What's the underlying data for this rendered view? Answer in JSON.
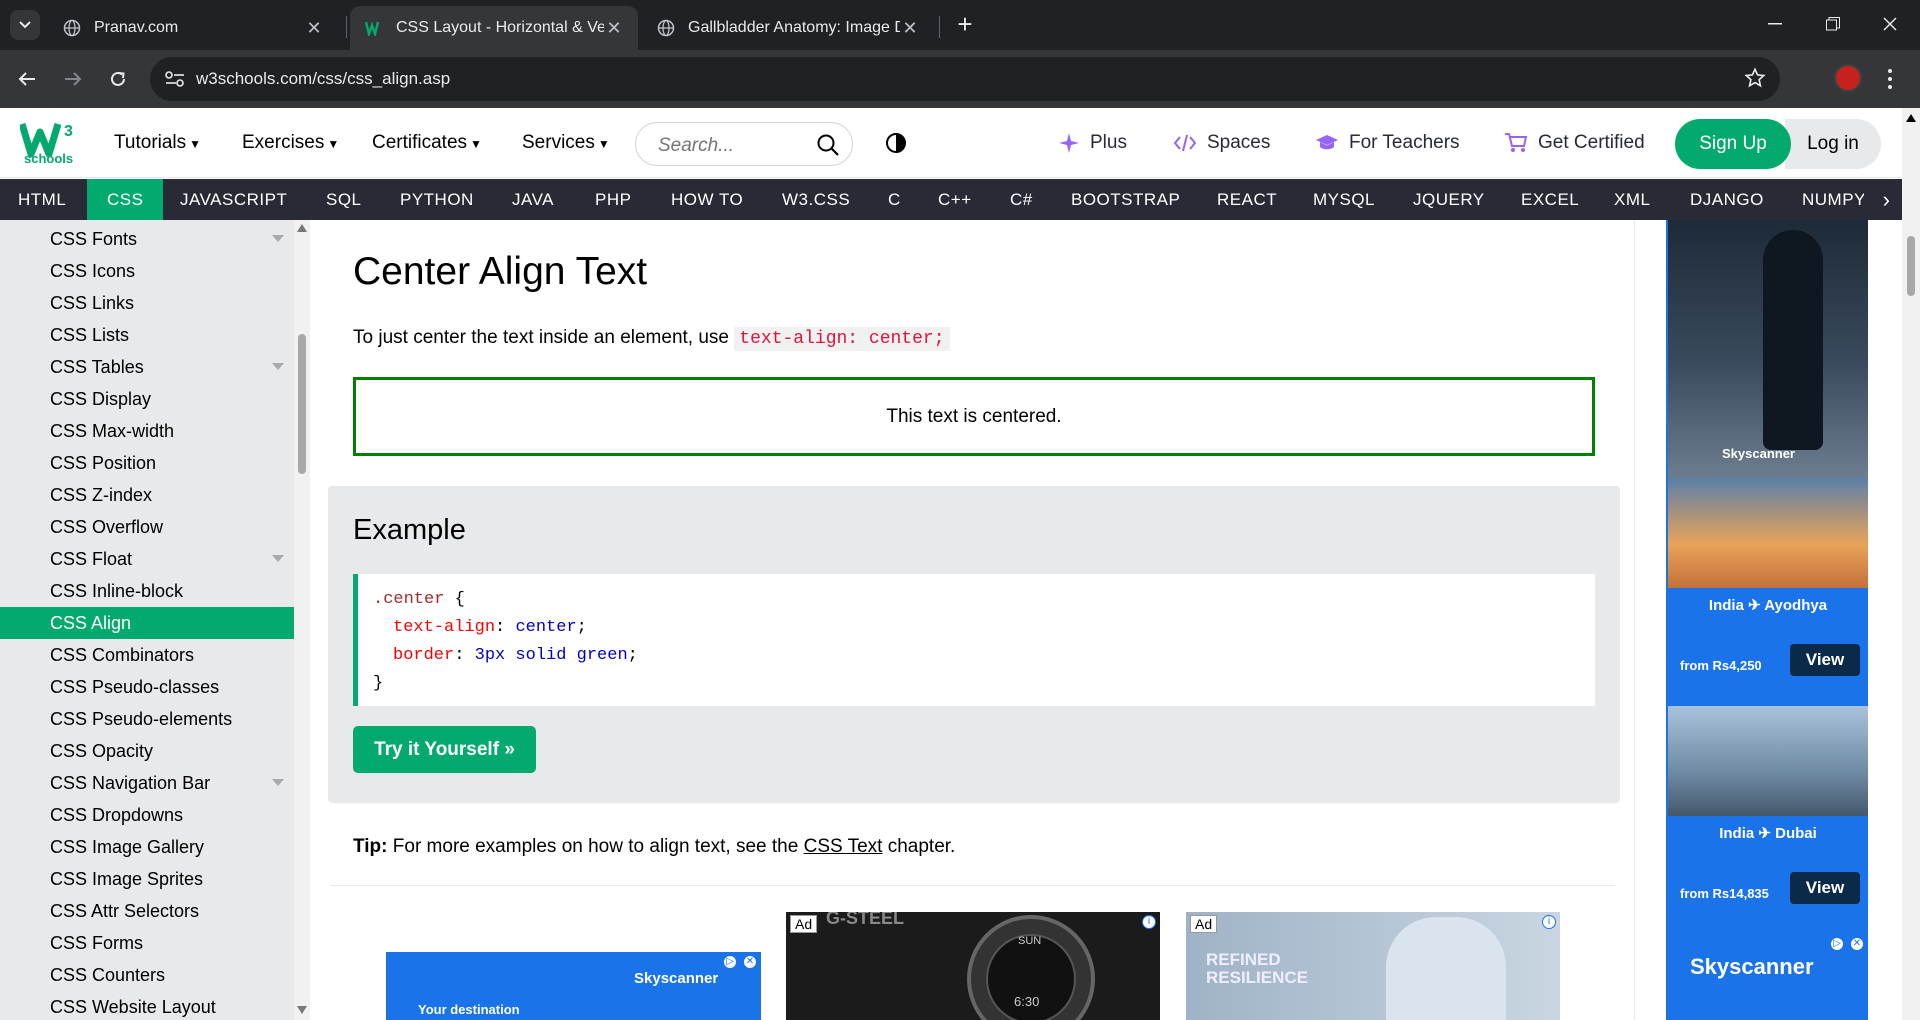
{
  "browser": {
    "tabs": [
      {
        "title": "Pranav.com",
        "active": false
      },
      {
        "title": "CSS Layout - Horizontal & Verti",
        "active": true
      },
      {
        "title": "Gallbladder Anatomy: Image De",
        "active": false
      }
    ],
    "url": "w3schools.com/css/css_align.asp"
  },
  "site": {
    "logo_text": "schools",
    "menu": [
      "Tutorials",
      "Exercises",
      "Certificates",
      "Services"
    ],
    "search_placeholder": "Search...",
    "right_links": [
      "Plus",
      "Spaces",
      "For Teachers",
      "Get Certified"
    ],
    "signup": "Sign Up",
    "login": "Log in"
  },
  "topnav": [
    "HTML",
    "CSS",
    "JAVASCRIPT",
    "SQL",
    "PYTHON",
    "JAVA",
    "PHP",
    "HOW TO",
    "W3.CSS",
    "C",
    "C++",
    "C#",
    "BOOTSTRAP",
    "REACT",
    "MYSQL",
    "JQUERY",
    "EXCEL",
    "XML",
    "DJANGO",
    "NUMPY"
  ],
  "topnav_active": "CSS",
  "sidebar": {
    "items": [
      {
        "label": "CSS Fonts",
        "caret": true
      },
      {
        "label": "CSS Icons"
      },
      {
        "label": "CSS Links"
      },
      {
        "label": "CSS Lists"
      },
      {
        "label": "CSS Tables",
        "caret": true
      },
      {
        "label": "CSS Display"
      },
      {
        "label": "CSS Max-width"
      },
      {
        "label": "CSS Position"
      },
      {
        "label": "CSS Z-index"
      },
      {
        "label": "CSS Overflow"
      },
      {
        "label": "CSS Float",
        "caret": true
      },
      {
        "label": "CSS Inline-block"
      },
      {
        "label": "CSS Align",
        "active": true
      },
      {
        "label": "CSS Combinators"
      },
      {
        "label": "CSS Pseudo-classes"
      },
      {
        "label": "CSS Pseudo-elements"
      },
      {
        "label": "CSS Opacity"
      },
      {
        "label": "CSS Navigation Bar",
        "caret": true
      },
      {
        "label": "CSS Dropdowns"
      },
      {
        "label": "CSS Image Gallery"
      },
      {
        "label": "CSS Image Sprites"
      },
      {
        "label": "CSS Attr Selectors"
      },
      {
        "label": "CSS Forms"
      },
      {
        "label": "CSS Counters"
      },
      {
        "label": "CSS Website Layout"
      }
    ]
  },
  "content": {
    "title": "Center Align Text",
    "intro": "To just center the text inside an element, use",
    "intro_code": "text-align: center;",
    "demo_text": "This text is centered.",
    "example_heading": "Example",
    "code": {
      "selector": ".center",
      "open": "{",
      "p1": "text-align",
      "v1": "center",
      "p2": "border",
      "v2": "3px solid green",
      "close": "}"
    },
    "try_button": "Try it Yourself »",
    "tip_label": "Tip:",
    "tip_text": "For more examples on how to align text, see the",
    "tip_link": "CSS Text",
    "tip_end": "chapter."
  },
  "ads": {
    "ad_label": "Ad",
    "skyscanner": "Skyscanner",
    "your_destination": "Your destination",
    "watch_brand": "G-STEEL",
    "watch_day": "SUN",
    "watch_time": "6:30",
    "fashion_text_1": "REFINED",
    "fashion_text_2": "RESILIENCE",
    "route1": "India ✈ Ayodhya",
    "price1": "from Rs4,250",
    "route2": "India ✈ Dubai",
    "price2": "from Rs14,835",
    "view": "View"
  },
  "colors": {
    "brand_green": "#04aa6d",
    "nav_dark": "#282a35",
    "sidebar_bg": "#e7e9eb",
    "ad_blue": "#1a73e8"
  }
}
